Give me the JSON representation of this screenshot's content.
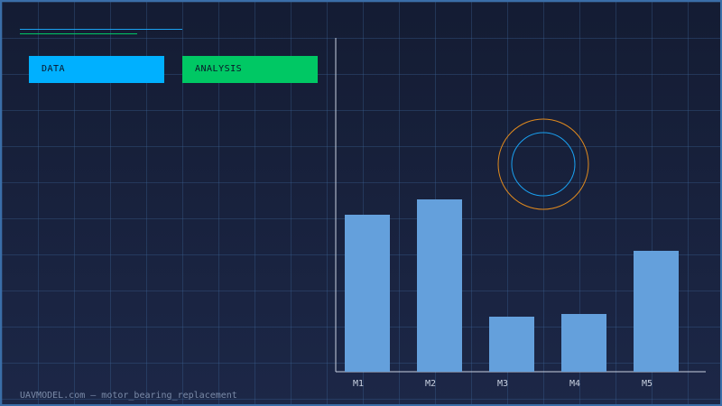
{
  "tags": {
    "data_label": "DATA",
    "analysis_label": "ANALYSIS"
  },
  "colors": {
    "data_tag": "#00b0ff",
    "analysis_tag": "#00c864",
    "bar": "#64a0dc",
    "axis": "#c8d0e0",
    "ring_outer": "#e08a1e",
    "ring_inner": "#1aa0f0",
    "deco_line_a": "#1aa0f0",
    "deco_line_b": "#00c864"
  },
  "footer": {
    "text": "UAVMODEL.com – motor_bearing_replacement"
  },
  "chart_data": {
    "type": "bar",
    "categories": [
      "M1",
      "M2",
      "M3",
      "M4",
      "M5"
    ],
    "values": [
      174,
      191,
      61,
      64,
      134
    ],
    "ylim": [
      0,
      370
    ],
    "grid": false,
    "title": "",
    "xlabel": "",
    "ylabel": ""
  }
}
